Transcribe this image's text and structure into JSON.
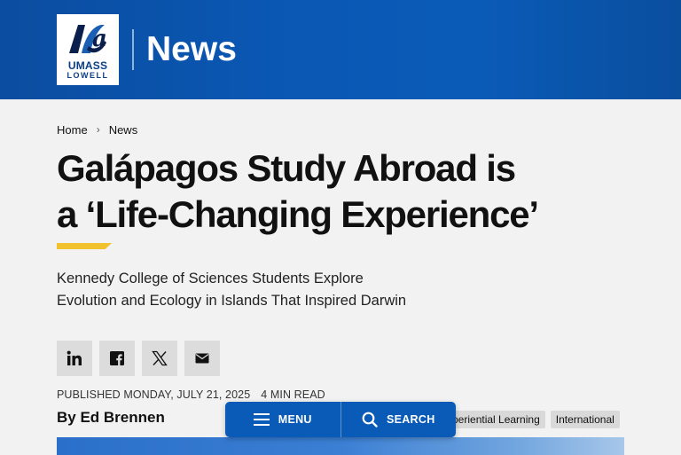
{
  "header": {
    "logo_line1": "UMASS",
    "logo_line2": "LOWELL",
    "section_title": "News"
  },
  "breadcrumb": [
    {
      "label": "Home"
    },
    {
      "label": "News"
    }
  ],
  "article": {
    "title_line1": "Galápagos Study Abroad is",
    "title_line2": "a ‘Life-Changing Experience’",
    "subtitle_line1": "Kennedy College of Sciences Students Explore",
    "subtitle_line2": "Evolution and Ecology in Islands That Inspired Darwin",
    "published": "PUBLISHED MONDAY, JULY 21, 2025",
    "read_time": "4 MIN READ",
    "byline": "By Ed Brennen",
    "tags": [
      "Experiential Learning",
      "International"
    ]
  },
  "share": [
    {
      "icon": "linkedin-icon"
    },
    {
      "icon": "facebook-icon"
    },
    {
      "icon": "x-twitter-icon"
    },
    {
      "icon": "email-icon"
    }
  ],
  "floating_nav": {
    "menu_label": "MENU",
    "search_label": "SEARCH"
  },
  "colors": {
    "brand_blue": "#0a5bb8",
    "accent_yellow": "#f2c12e",
    "share_bg": "#dcdcdc",
    "tag_bg": "#d9d9d9"
  }
}
